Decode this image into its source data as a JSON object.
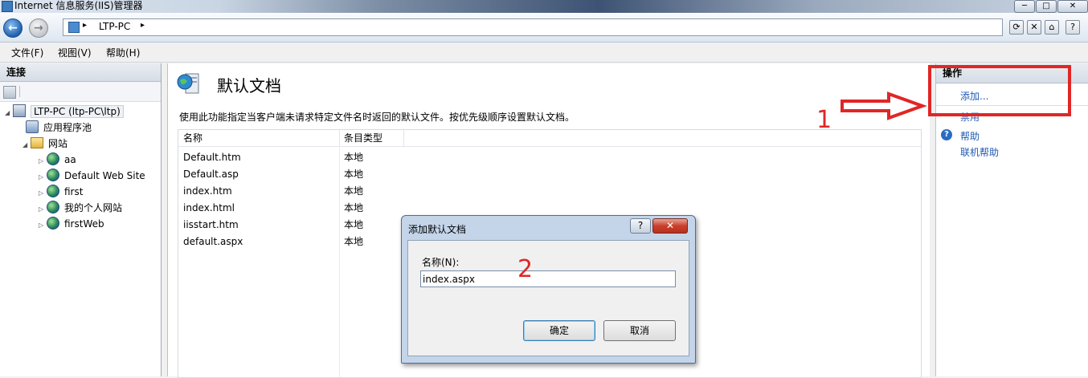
{
  "window": {
    "title": "Internet 信息服务(IIS)管理器",
    "min": "─",
    "max": "□",
    "close": "✕"
  },
  "nav": {
    "back_icon": "back-arrow-icon",
    "address": "LTP-PC",
    "sep": "▸"
  },
  "menu": [
    {
      "label": "文件(F)"
    },
    {
      "label": "视图(V)"
    },
    {
      "label": "帮助(H)"
    }
  ],
  "connections": {
    "header": "连接",
    "tree": [
      {
        "label": "LTP-PC (ltp-PC\\ltp)",
        "icon": "server-icon",
        "level": 0,
        "expander": "◢"
      },
      {
        "label": "应用程序池",
        "icon": "app-pool-icon",
        "level": 1,
        "expander": ""
      },
      {
        "label": "网站",
        "icon": "sites-folder-icon",
        "level": 1,
        "expander": "◢"
      },
      {
        "label": "aa",
        "icon": "globe-icon",
        "level": 2,
        "expander": "▷"
      },
      {
        "label": "Default Web Site",
        "icon": "globe-icon",
        "level": 2,
        "expander": "▷"
      },
      {
        "label": "first",
        "icon": "globe-icon",
        "level": 2,
        "expander": "▷"
      },
      {
        "label": "我的个人网站",
        "icon": "globe-icon",
        "level": 2,
        "expander": "▷"
      },
      {
        "label": "firstWeb",
        "icon": "globe-icon",
        "level": 2,
        "expander": "▷"
      }
    ]
  },
  "main": {
    "title": "默认文档",
    "description": "使用此功能指定当客户端未请求特定文件名时返回的默认文件。按优先级顺序设置默认文档。",
    "columns": [
      "名称",
      "条目类型"
    ],
    "rows": [
      {
        "name": "Default.htm",
        "type": "本地"
      },
      {
        "name": "Default.asp",
        "type": "本地"
      },
      {
        "name": "index.htm",
        "type": "本地"
      },
      {
        "name": "index.html",
        "type": "本地"
      },
      {
        "name": "iisstart.htm",
        "type": "本地"
      },
      {
        "name": "default.aspx",
        "type": "本地"
      }
    ]
  },
  "actions": {
    "header": "操作",
    "add": "添加...",
    "disable": "禁用",
    "help": "帮助",
    "online_help": "联机帮助"
  },
  "dialog": {
    "title": "添加默认文档",
    "help_btn": "?",
    "close_btn": "✕",
    "label": "名称(N):",
    "value": "index.aspx",
    "ok": "确定",
    "cancel": "取消"
  },
  "annotations": {
    "one": "1",
    "two": "2"
  },
  "colors": {
    "accent": "#1f5ab4",
    "annotation": "#e02626"
  }
}
